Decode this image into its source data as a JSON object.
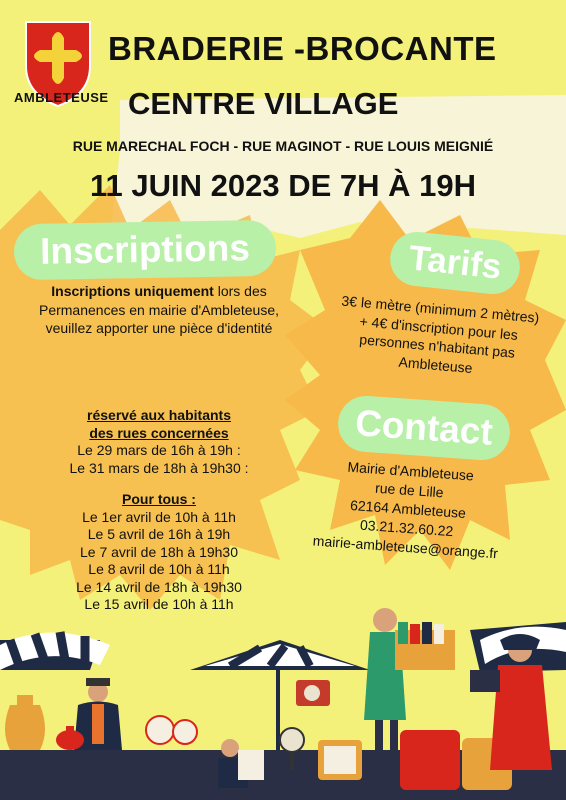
{
  "logo": {
    "name": "AMBLETEUSE"
  },
  "header": {
    "title_line1": "BRADERIE -BROCANTE",
    "title_line2": "CENTRE VILLAGE",
    "streets": "RUE MARECHAL FOCH - RUE MAGINOT - RUE LOUIS MEIGNIÉ",
    "date": "11 JUIN 2023 DE 7H À 19H"
  },
  "inscriptions": {
    "heading": "Inscriptions",
    "intro_bold": "Inscriptions uniquement",
    "intro_rest": " lors des Permanences en mairie d'Ambleteuse,",
    "intro_line2": "veuillez apporter une pièce d'identité",
    "residents_heading_l1": "réservé aux habitants",
    "residents_heading_l2": "des rues concernées",
    "residents_dates": [
      "Le 29 mars de 16h à 19h :",
      "Le 31 mars de 18h à 19h30 :"
    ],
    "all_heading": "Pour tous :",
    "all_dates": [
      "Le 1er avril de 10h à 11h",
      "Le 5 avril de 16h à 19h",
      "Le 7 avril de 18h à 19h30",
      "Le 8 avril de 10h à 11h",
      "Le 14 avril de 18h à 19h30",
      "Le 15 avril de 10h à 11h"
    ]
  },
  "tarifs": {
    "heading": "Tarifs",
    "line1": "3€ le mètre (minimum 2 mètres)",
    "line2": "+ 4€ d'inscription pour les",
    "line3": "personnes n'habitant pas",
    "line4": "Ambleteuse"
  },
  "contact": {
    "heading": "Contact",
    "lines": [
      "Mairie d'Ambleteuse",
      "rue de Lille",
      "62164 Ambleteuse",
      "03.21.32.60.22",
      "mairie-ambleteuse@orange.fr"
    ]
  },
  "colors": {
    "background": "#f4f17a",
    "burst": "#f7b94a",
    "pill": "#b8f0a8",
    "shield_red": "#d9261c"
  }
}
